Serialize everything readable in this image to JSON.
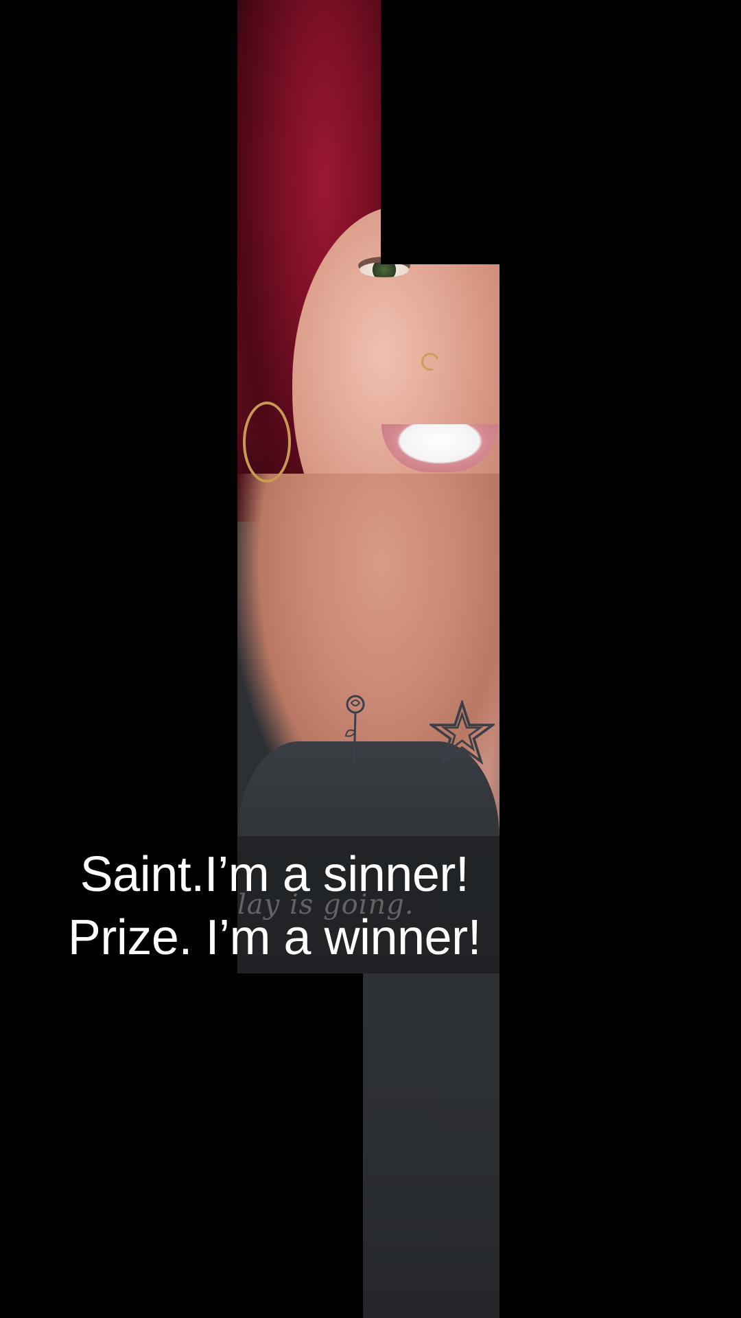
{
  "caption": {
    "line1": "Saint.I’m a sinner!",
    "line2": "Prize. I’m a winner!"
  },
  "photo": {
    "watermark_text": "lay is going."
  },
  "colors": {
    "background": "#000000",
    "caption_text": "#ffffff",
    "hair": "#7a0f26",
    "shirt": "#2c2f34"
  }
}
